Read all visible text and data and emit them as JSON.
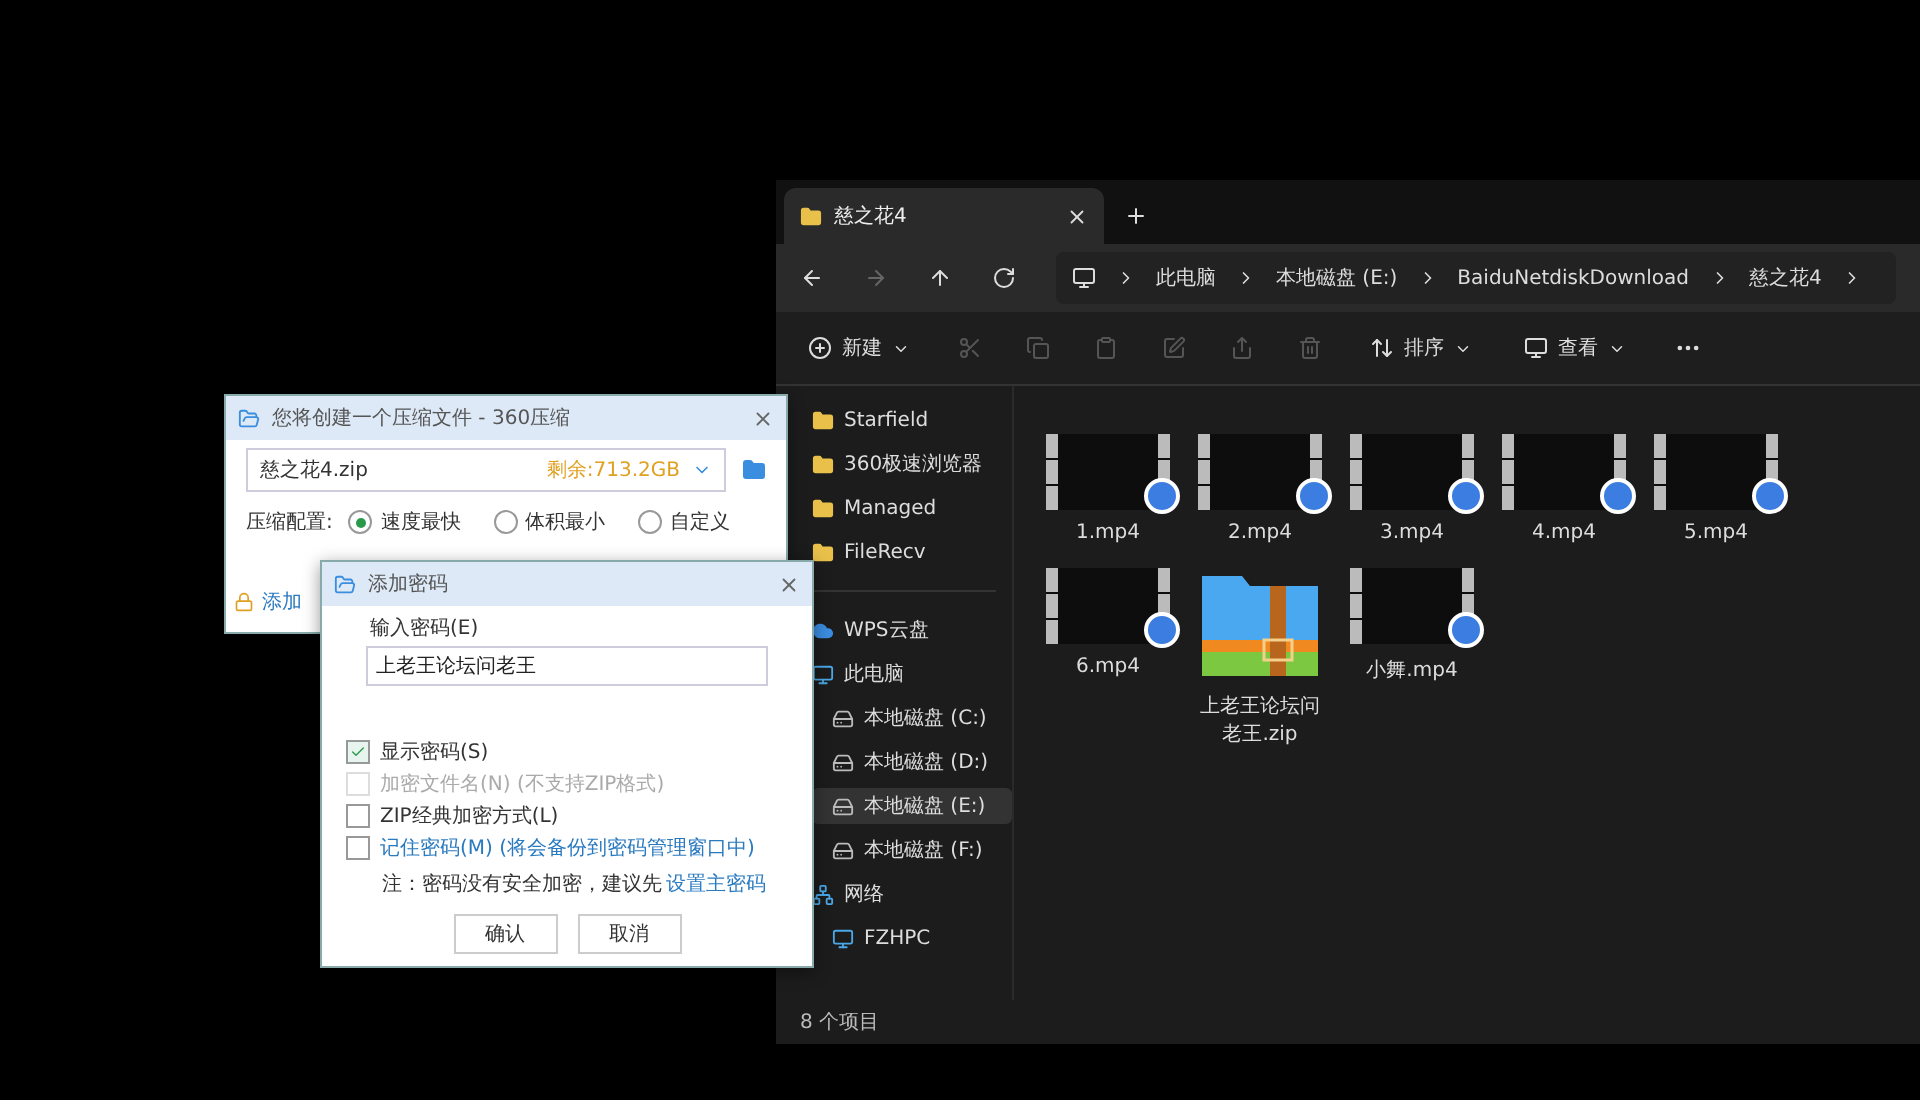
{
  "explorer": {
    "tab": {
      "title": "慈之花4",
      "selected": true
    },
    "breadcrumb": [
      "此电脑",
      "本地磁盘 (E:)",
      "BaiduNetdiskDownload",
      "慈之花4"
    ],
    "toolbar": [
      {
        "kind": "new",
        "label": "新建"
      },
      {
        "kind": "sort",
        "label": "排序"
      },
      {
        "kind": "view",
        "label": "查看"
      }
    ],
    "sidebar": {
      "items": [
        {
          "kind": "folder",
          "label": "Starfield",
          "selected": false
        },
        {
          "kind": "folder",
          "label": "360极速浏览器",
          "selected": false
        },
        {
          "kind": "folder",
          "label": "Managed",
          "selected": false
        },
        {
          "kind": "folder",
          "label": "FileRecv",
          "selected": false
        },
        {
          "kind": "cloud",
          "label": "WPS云盘",
          "selected": false
        },
        {
          "kind": "pc",
          "label": "此电脑",
          "selected": false,
          "children": [
            {
              "kind": "drive",
              "label": "本地磁盘 (C:)",
              "selected": false
            },
            {
              "kind": "drive",
              "label": "本地磁盘 (D:)",
              "selected": false
            },
            {
              "kind": "drive",
              "label": "本地磁盘 (E:)",
              "selected": true
            },
            {
              "kind": "drive",
              "label": "本地磁盘 (F:)",
              "selected": false
            }
          ]
        },
        {
          "kind": "network",
          "label": "网络",
          "selected": false,
          "children": [
            {
              "kind": "pc",
              "label": "FZHPC",
              "selected": false
            }
          ]
        }
      ]
    },
    "files": [
      {
        "kind": "video",
        "name": "1.mp4"
      },
      {
        "kind": "video",
        "name": "2.mp4"
      },
      {
        "kind": "video",
        "name": "3.mp4"
      },
      {
        "kind": "video",
        "name": "4.mp4"
      },
      {
        "kind": "video",
        "name": "5.mp4"
      },
      {
        "kind": "video",
        "name": "6.mp4"
      },
      {
        "kind": "zip",
        "name": "上老王论坛问老王.zip"
      },
      {
        "kind": "video",
        "name": "小舞.mp4"
      }
    ],
    "status_bar": "8 个项目"
  },
  "compress_dialog": {
    "title": "您将创建一个压缩文件 - 360压缩",
    "filename": "慈之花4.zip",
    "free_space": "剩余:713.2GB",
    "config_label": "压缩配置:",
    "options": [
      {
        "label": "速度最快",
        "selected": true
      },
      {
        "label": "体积最小",
        "selected": false
      },
      {
        "label": "自定义",
        "selected": false
      }
    ],
    "password_link": "添加"
  },
  "password_dialog": {
    "title": "添加密码",
    "field_label": "输入密码(E)",
    "value": "上老王论坛问老王",
    "checkboxes": [
      {
        "label": "显示密码(S)",
        "checked": true,
        "disabled": false
      },
      {
        "label": "加密文件名(N) (不支持ZIP格式)",
        "checked": false,
        "disabled": true
      },
      {
        "label": "ZIP经典加密方式(L)",
        "checked": false,
        "disabled": false
      },
      {
        "label": "记住密码(M) (将会备份到密码管理窗口中)",
        "checked": false,
        "disabled": false,
        "link": true
      }
    ],
    "note": "注：密码没有安全加密，建议先",
    "note_link": "设置主密码",
    "buttons": [
      "确认",
      "取消"
    ]
  }
}
